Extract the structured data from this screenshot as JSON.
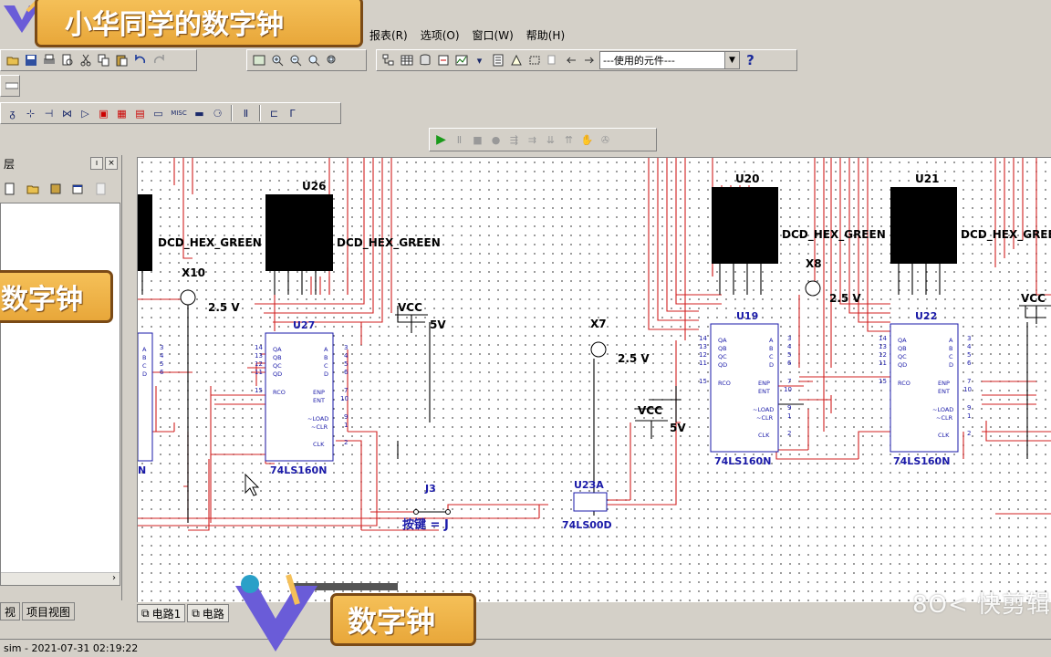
{
  "menus": [
    "报表(R)",
    "选项(O)",
    "窗口(W)",
    "帮助(H)"
  ],
  "toolbar": {
    "in_use_combo": "---使用的元件---",
    "help_icon": "?",
    "misc_label": "MISC"
  },
  "left_panel": {
    "title": "层",
    "pin_btn": "ı",
    "close_btn": "×",
    "scroll_right": "›",
    "tabs": [
      "视",
      "项目视图"
    ]
  },
  "doc_tabs": [
    "电路1",
    "电路"
  ],
  "status": {
    "text": "sim  -  2021-07-31 02:19:22"
  },
  "overlays": {
    "top_banner": "小华同学的数字钟",
    "left_banner": "数字钟",
    "bottom_banner": "数字钟",
    "watermark": "8O< 快剪辑"
  },
  "schematic": {
    "displays": [
      {
        "ref": "",
        "model": "DCD_HEX_GREEN"
      },
      {
        "ref": "U26",
        "model": "DCD_HEX_GREEN"
      },
      {
        "ref": "U20",
        "model": "DCD_HEX_GREEN"
      },
      {
        "ref": "U21",
        "model": "DCD_HEX_GREEN"
      }
    ],
    "counters": [
      {
        "ref": "U27",
        "model": "74LS160N"
      },
      {
        "ref": "U19",
        "model": "74LS160N"
      },
      {
        "ref": "U22",
        "model": "74LS160N"
      },
      {
        "ref": "",
        "model": "N"
      }
    ],
    "probes": [
      "X10",
      "X8",
      "X7"
    ],
    "voltages": [
      "2.5 V",
      "2.5 V",
      "2.5 V"
    ],
    "vcc": [
      {
        "label": "VCC",
        "value": "5V"
      },
      {
        "label": "VCC",
        "value": "5V"
      },
      {
        "label": "VCC",
        "value": ""
      }
    ],
    "switch": {
      "ref": "J3",
      "label": "按键 = J"
    },
    "gate": {
      "ref": "U23A",
      "model": "74LS00D"
    },
    "pins_left": [
      "A",
      "B",
      "C",
      "D"
    ],
    "pins_q": [
      "QA",
      "QB",
      "QC",
      "QD"
    ],
    "pins_ctrl": [
      "RCO",
      "ENP",
      "ENT",
      "~LOAD",
      "~CLR",
      "CLK"
    ],
    "pin_numbers": [
      "14",
      "13",
      "12",
      "11",
      "15",
      "3",
      "4",
      "5",
      "6",
      "7",
      "10",
      "9",
      "1",
      "2"
    ]
  }
}
